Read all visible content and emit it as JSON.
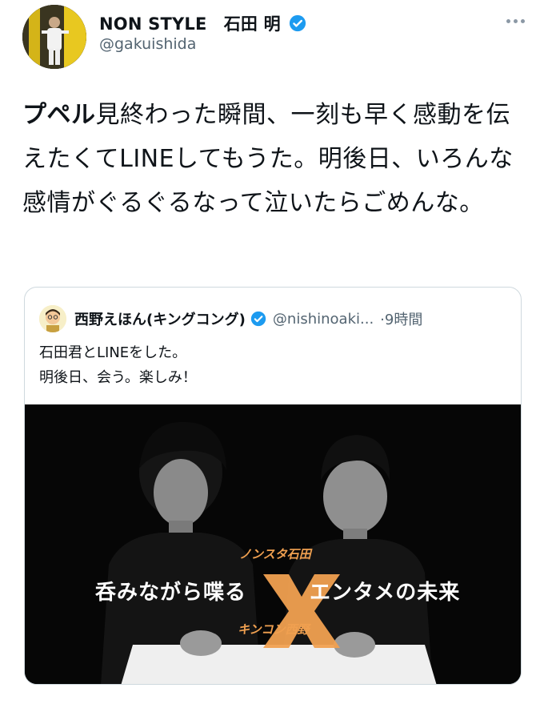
{
  "author": {
    "display_name": "NON STYLE　石田 明",
    "handle": "@gakuishida"
  },
  "tweet": {
    "bold_prefix": "プペル",
    "text": "見終わった瞬間、一刻も早く感動を伝えたくてLINEしてもうた。明後日、いろんな感情がぐるぐるなって泣いたらごめんな。"
  },
  "quote": {
    "display_name": "西野えほん(キングコング)",
    "handle": "@nishinoaki...",
    "time": "·9時間",
    "lines": [
      "石田君とLINEをした。",
      "明後日、会う。楽しみ！"
    ],
    "image": {
      "caption_top": "ノンスタ石田",
      "caption_left": "呑みながら喋る",
      "caption_right": "エンタメの未来",
      "caption_bottom": "キンコン西野"
    }
  },
  "icons": [
    "verified-badge-icon",
    "more-options-icon"
  ],
  "colors": {
    "verified": "#1d9bf0",
    "accent_x": "#f0a050",
    "secondary_text": "#536471"
  }
}
